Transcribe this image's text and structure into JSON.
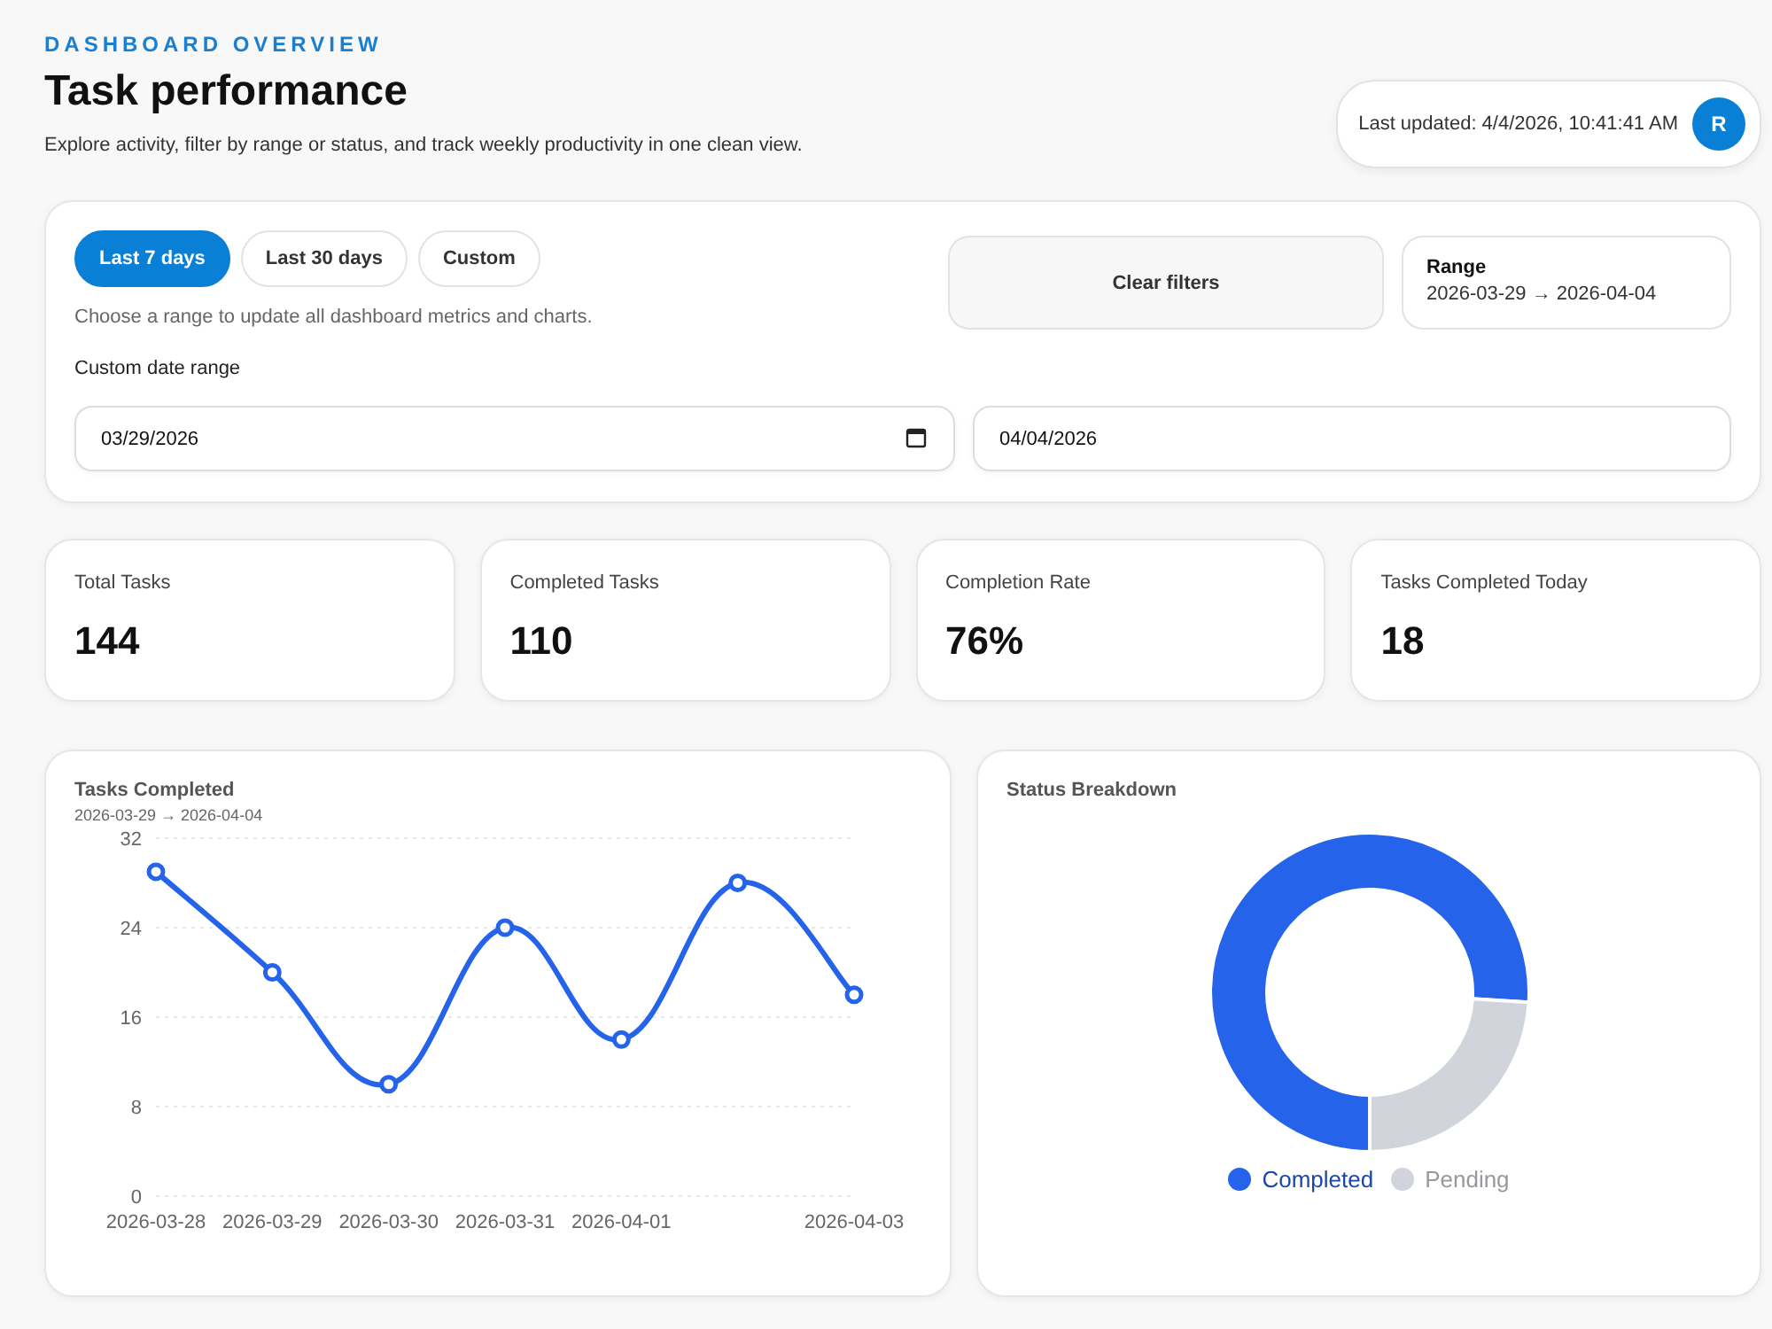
{
  "header": {
    "eyebrow": "DASHBOARD OVERVIEW",
    "title": "Task performance",
    "subtitle": "Explore activity, filter by range or status, and track weekly productivity in one clean view.",
    "last_updated": "Last updated: 4/4/2026, 10:41:41 AM",
    "refresh_button": "R"
  },
  "filters": {
    "ranges": [
      {
        "label": "Last 7 days",
        "selected": true
      },
      {
        "label": "Last 30 days",
        "selected": false
      },
      {
        "label": "Custom",
        "selected": false
      }
    ],
    "hint": "Choose a range to update all dashboard metrics and charts.",
    "clear_button": "Clear filters",
    "range": {
      "label": "Range",
      "value": "2026-03-29 → 2026-04-04"
    },
    "custom_label": "Custom date range",
    "dates": [
      {
        "value": "03/29/2026",
        "calendar_icon": true
      },
      {
        "value": "04/04/2026",
        "calendar_icon": false
      }
    ]
  },
  "stats": [
    {
      "label": "Total Tasks",
      "value": "144"
    },
    {
      "label": "Completed Tasks",
      "value": "110"
    },
    {
      "label": "Completion Rate",
      "value": "76%"
    },
    {
      "label": "Tasks Completed Today",
      "value": "18"
    }
  ],
  "line_card": {
    "title": "Tasks Completed",
    "subtitle": "2026-03-29 → 2026-04-04",
    "chart_data": {
      "type": "line",
      "categories": [
        "2026-03-28",
        "2026-03-29",
        "2026-03-30",
        "2026-03-31",
        "2026-04-01",
        null,
        "2026-04-03"
      ],
      "series": [
        {
          "color": "#2563eb",
          "marker": true,
          "values": [
            29,
            20,
            10,
            24,
            14,
            28,
            18
          ]
        }
      ],
      "ylim": [
        0,
        32
      ],
      "yticks": [
        0,
        8,
        16,
        24,
        32
      ],
      "grid": true
    }
  },
  "donut_card": {
    "title": "Status Breakdown",
    "chart_data": {
      "type": "donut",
      "categories": [
        "Completed",
        "Pending"
      ],
      "values": [
        76,
        24
      ],
      "colors": [
        "#2563eb",
        "#d1d5db"
      ],
      "legend": "bottom"
    }
  }
}
